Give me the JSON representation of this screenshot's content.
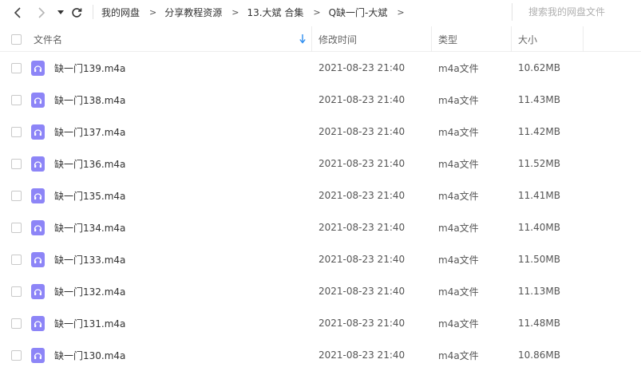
{
  "toolbar": {
    "back_icon": "chevron-left-icon",
    "forward_icon": "chevron-right-icon",
    "history_icon": "caret-down-icon",
    "refresh_icon": "refresh-icon",
    "breadcrumb": [
      "我的网盘",
      "分享教程资源",
      "13.大斌 合集",
      "Q缺一门-大斌"
    ],
    "separator": ">",
    "search_placeholder": "搜索我的网盘文件"
  },
  "table": {
    "columns": {
      "name": "文件名",
      "modified": "修改时间",
      "type": "类型",
      "size": "大小"
    },
    "sort_icon": "sort-down-arrow-icon",
    "file_icon": "audio-file-icon",
    "icon_color": "#8d85f7",
    "rows": [
      {
        "name": "缺一门139.m4a",
        "modified": "2021-08-23 21:40",
        "type": "m4a文件",
        "size": "10.62MB"
      },
      {
        "name": "缺一门138.m4a",
        "modified": "2021-08-23 21:40",
        "type": "m4a文件",
        "size": "11.43MB"
      },
      {
        "name": "缺一门137.m4a",
        "modified": "2021-08-23 21:40",
        "type": "m4a文件",
        "size": "11.42MB"
      },
      {
        "name": "缺一门136.m4a",
        "modified": "2021-08-23 21:40",
        "type": "m4a文件",
        "size": "11.52MB"
      },
      {
        "name": "缺一门135.m4a",
        "modified": "2021-08-23 21:40",
        "type": "m4a文件",
        "size": "11.41MB"
      },
      {
        "name": "缺一门134.m4a",
        "modified": "2021-08-23 21:40",
        "type": "m4a文件",
        "size": "11.40MB"
      },
      {
        "name": "缺一门133.m4a",
        "modified": "2021-08-23 21:40",
        "type": "m4a文件",
        "size": "11.50MB"
      },
      {
        "name": "缺一门132.m4a",
        "modified": "2021-08-23 21:40",
        "type": "m4a文件",
        "size": "11.13MB"
      },
      {
        "name": "缺一门131.m4a",
        "modified": "2021-08-23 21:40",
        "type": "m4a文件",
        "size": "11.48MB"
      },
      {
        "name": "缺一门130.m4a",
        "modified": "2021-08-23 21:40",
        "type": "m4a文件",
        "size": "10.86MB"
      }
    ]
  }
}
